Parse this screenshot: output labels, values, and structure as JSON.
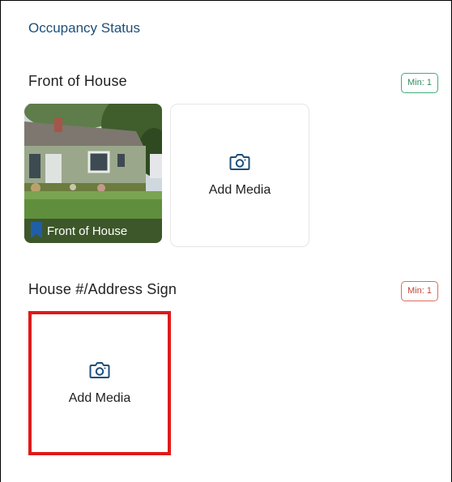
{
  "section": {
    "title": "Occupancy Status"
  },
  "groups": [
    {
      "title": "Front of House",
      "min_badge": "Min: 1",
      "badge_color": "#2f8f5f",
      "photos": [
        {
          "caption": "Front of House"
        }
      ],
      "add_media_label": "Add Media"
    },
    {
      "title": "House #/Address Sign",
      "min_badge": "Min: 1",
      "badge_color": "#c8463a",
      "add_media_label": "Add Media",
      "highlight_color": "#e01919"
    }
  ],
  "icons": {
    "camera": "camera-icon",
    "bookmark": "bookmark-icon"
  },
  "colors": {
    "header_text": "#1d4e7a",
    "bookmark": "#1f5fa8"
  }
}
